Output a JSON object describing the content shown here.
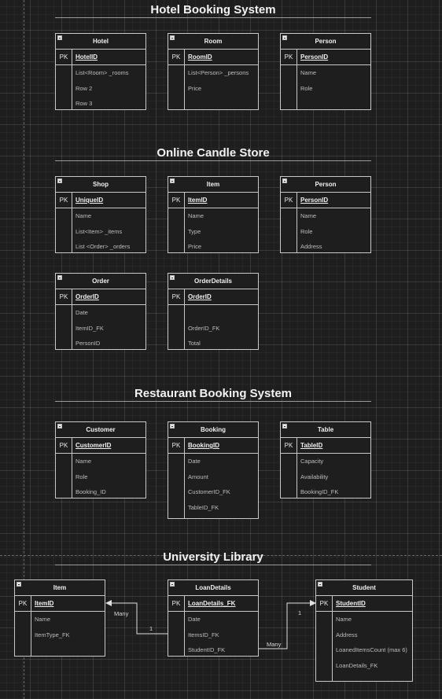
{
  "sections": {
    "hotel": "Hotel Booking System",
    "candle": "Online Candle Store",
    "restaurant": "Restaurant Booking System",
    "library": "University Library"
  },
  "key_label": "PK",
  "entities": {
    "hotel_hotel": {
      "title": "Hotel",
      "pk": "HotelID",
      "fields": [
        "List<Room> _rooms",
        "Row 2",
        "Row 3"
      ]
    },
    "hotel_room": {
      "title": "Room",
      "pk": "RoomID",
      "fields": [
        "List<Person> _persons",
        "Price"
      ]
    },
    "hotel_person": {
      "title": "Person",
      "pk": "PersonID",
      "fields": [
        "Name",
        "Role"
      ]
    },
    "candle_shop": {
      "title": "Shop",
      "pk": "UniqueID",
      "fields": [
        "Name",
        "List<Item> _items",
        "List <Order> _orders"
      ]
    },
    "candle_item": {
      "title": "Item",
      "pk": "ItemID",
      "fields": [
        "Name",
        "Type",
        "Price"
      ]
    },
    "candle_person": {
      "title": "Person",
      "pk": "PersonID",
      "fields": [
        "Name",
        "Role",
        "Address"
      ]
    },
    "candle_order": {
      "title": "Order",
      "pk": "OrderID",
      "fields": [
        "Date",
        "ItemID_FK",
        "PersonID"
      ]
    },
    "candle_orderdetails": {
      "title": "OrderDetails",
      "pk": "OrderID",
      "fields": [
        "",
        "OrderID_FK",
        "Total"
      ]
    },
    "rest_customer": {
      "title": "Customer",
      "pk": "CustomerID",
      "fields": [
        "Name",
        "Role",
        "Booking_ID"
      ]
    },
    "rest_booking": {
      "title": "Booking",
      "pk": "BookingID",
      "fields": [
        "Date",
        "Amount",
        "CustomerID_FK",
        "TableID_FK"
      ]
    },
    "rest_table": {
      "title": "Table",
      "pk": "TableID",
      "fields": [
        "Capacity",
        "Availability",
        "BookingID_FK"
      ]
    },
    "lib_item": {
      "title": "Item",
      "pk": "ItemID",
      "fields": [
        "Name",
        "ItemType_FK"
      ]
    },
    "lib_loandetails": {
      "title": "LoanDetails",
      "pk": "LoanDetails_FK",
      "fields": [
        "Date",
        "ItemsID_FK",
        "StudentID_FK"
      ]
    },
    "lib_student": {
      "title": "Student",
      "pk": "StudentID",
      "fields": [
        "Name",
        "Address",
        "LoanedItemsCount (max 6)",
        "LoanDetails_FK"
      ]
    }
  },
  "relationships": [
    {
      "from": "lib_loandetails",
      "to": "lib_item",
      "from_label": "1",
      "to_label": "Many"
    },
    {
      "from": "lib_loandetails",
      "to": "lib_student",
      "from_label": "Many",
      "to_label": "1"
    }
  ]
}
